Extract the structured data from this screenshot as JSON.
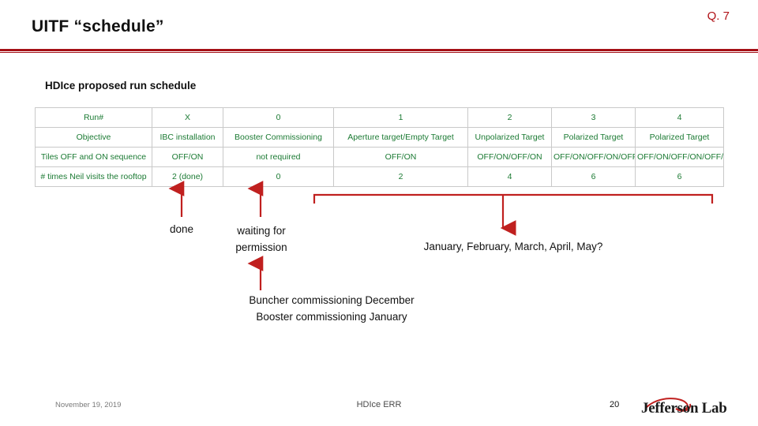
{
  "header": {
    "title": "UITF “schedule”",
    "q_label": "Q. 7"
  },
  "subtitle": "HDIce proposed run schedule",
  "table": {
    "rows": [
      {
        "label": "Run#",
        "cells": [
          "X",
          "0",
          "1",
          "2",
          "3",
          "4"
        ]
      },
      {
        "label": "Objective",
        "cells": [
          "IBC installation",
          "Booster Commissioning",
          "Aperture target/Empty Target",
          "Unpolarized Target",
          "Polarized Target",
          "Polarized Target"
        ]
      },
      {
        "label": "Tiles OFF and ON sequence",
        "cells": [
          "OFF/ON",
          "not required",
          "OFF/ON",
          "OFF/ON/OFF/ON",
          "OFF/ON/OFF/ON/OFF/ON",
          "OFF/ON/OFF/ON/OFF/ON"
        ]
      },
      {
        "label": "# times Neil visits the rooftop",
        "cells": [
          "2 (done)",
          "0",
          "2",
          "4",
          "6",
          "6"
        ]
      }
    ]
  },
  "annotations": {
    "done": "done",
    "waiting": "waiting for\npermission",
    "months": "January, February, March, April, May?",
    "buncher": "Buncher commissioning December\nBooster commissioning January"
  },
  "footer": {
    "date": "November 19, 2019",
    "center": "HDIce ERR",
    "page": "20",
    "logo_text": "Jefferson Lab"
  },
  "colors": {
    "accent_red": "#a51017",
    "table_text_green": "#1b7a33",
    "annotation_red": "#c0201f",
    "footer_gray": "#7a7a7a"
  }
}
